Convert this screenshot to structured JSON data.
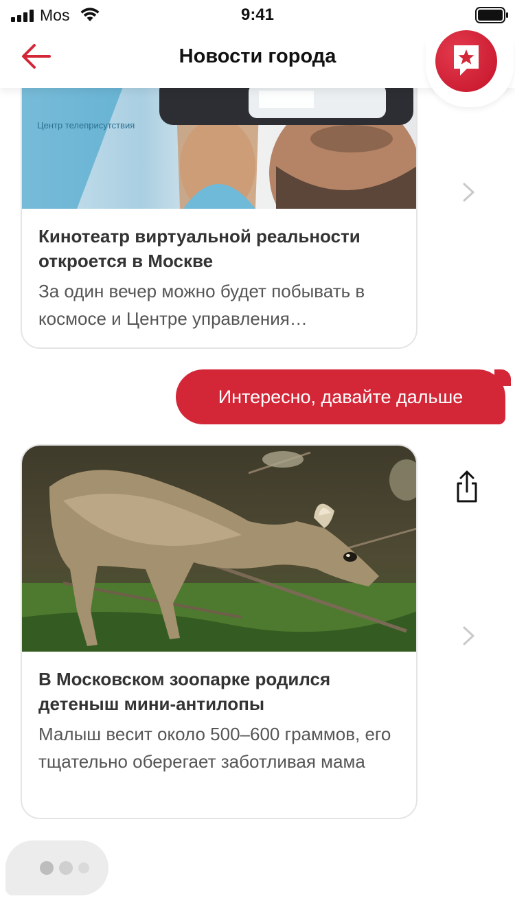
{
  "status_bar": {
    "carrier": "Mos",
    "time": "9:41"
  },
  "header": {
    "title": "Новости города",
    "back_icon": "arrow-left-icon",
    "logo_icon": "star-bookmark-icon",
    "accent_color": "#d32738"
  },
  "messages": {
    "card1": {
      "title": "Кинотеатр виртуальной реальности откроется в Москве",
      "description": "За один вечер можно будет побывать в космосе и Центре управления…",
      "image_text": "Центр телеприсутствия"
    },
    "user_reply": "Интересно, давайте дальше",
    "card2": {
      "title": "В Московском зоопарке родился детеныш мини-антилопы",
      "description": "Малыш весит около 500–600 граммов, его тщательно оберегает заботливая мама"
    },
    "typing_indicator_icon": "typing-dots-icon"
  }
}
